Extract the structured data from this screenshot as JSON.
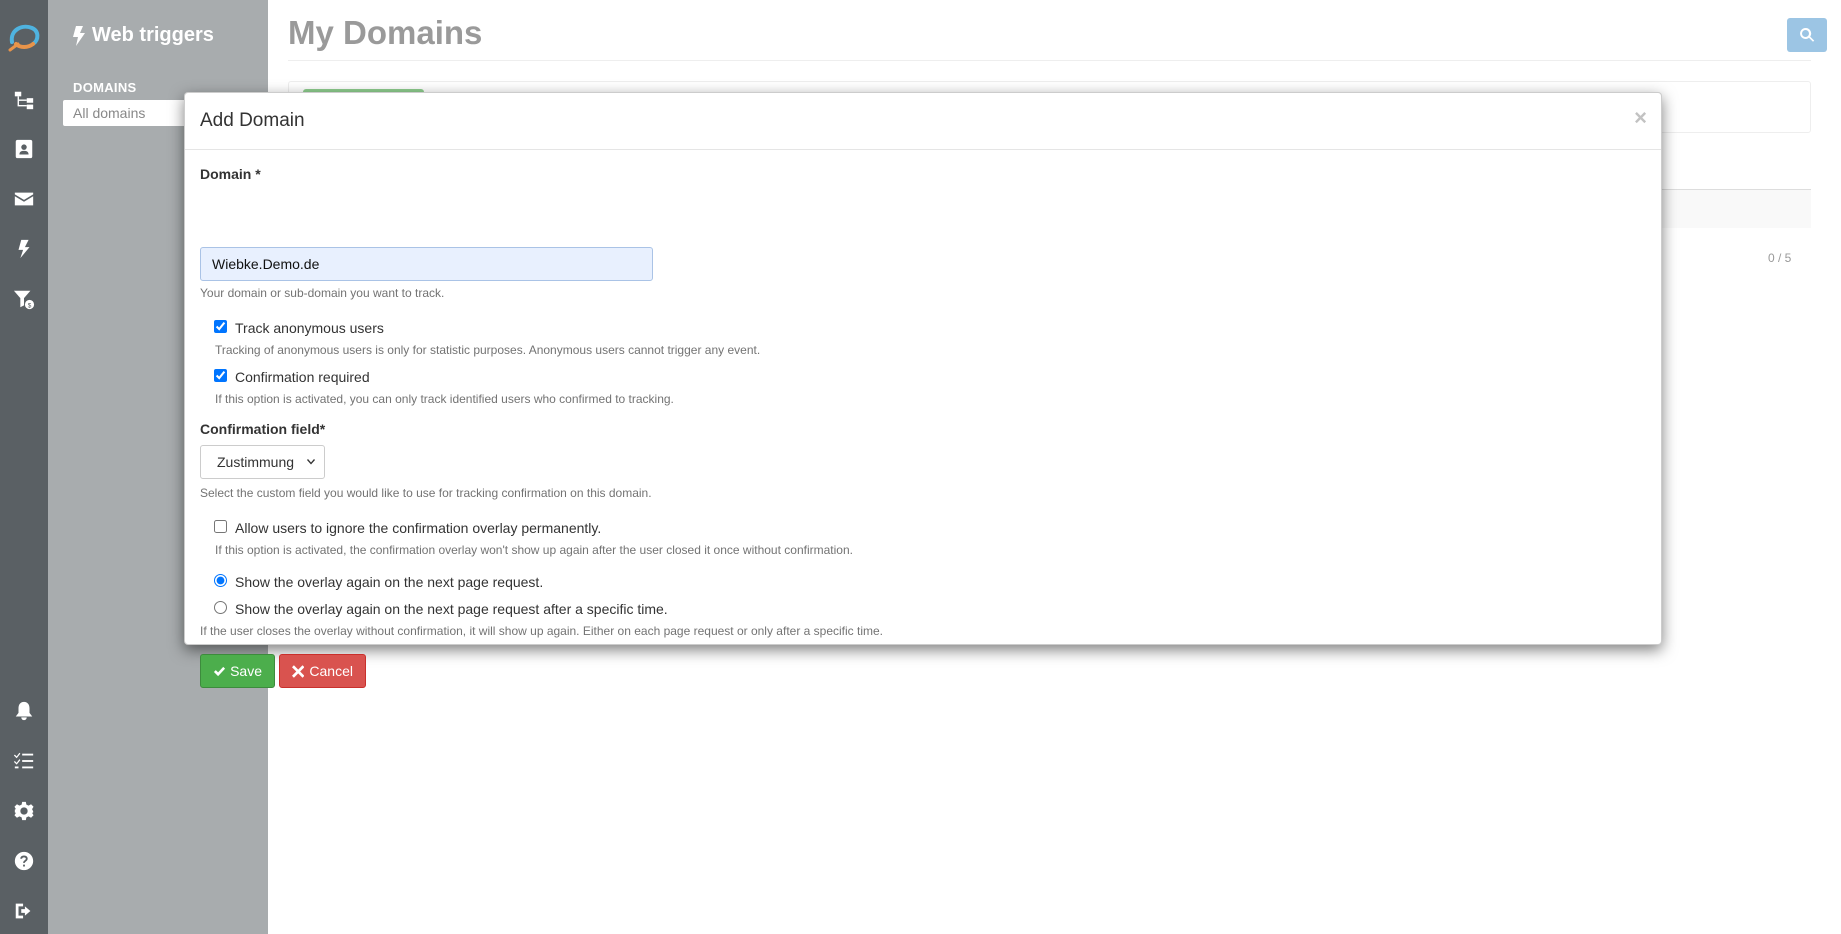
{
  "app": {
    "section_title": "Web triggers",
    "sidebar_heading": "DOMAINS",
    "sidebar_item": "All domains"
  },
  "main": {
    "page_title": "My Domains",
    "pagination_count": "0 / 5"
  },
  "modal": {
    "title": "Add Domain",
    "close": "×",
    "domain_label": "Domain *",
    "domain_value": "Wiebke.Demo.de",
    "domain_help": "Your domain or sub-domain you want to track.",
    "track_anon_label": "Track anonymous users",
    "track_anon_checked": true,
    "track_anon_help": "Tracking of anonymous users is only for statistic purposes. Anonymous users cannot trigger any event.",
    "confirm_req_label": "Confirmation required",
    "confirm_req_checked": true,
    "confirm_req_help": "If this option is activated, you can only track identified users who confirmed to tracking.",
    "confirm_field_label": "Confirmation field*",
    "confirm_field_value": "Zustimmung",
    "confirm_field_help": "Select the custom field you would like to use for tracking confirmation on this domain.",
    "allow_ignore_label": "Allow users to ignore the confirmation overlay permanently.",
    "allow_ignore_checked": false,
    "allow_ignore_help": "If this option is activated, the confirmation overlay won't show up again after the user closed it once without confirmation.",
    "radio_next_label": "Show the overlay again on the next page request.",
    "radio_time_label": "Show the overlay again on the next page request after a specific time.",
    "radio_selected": "next",
    "radio_help": "If the user closes the overlay without confirmation, it will show up again. Either on each page request or only after a specific time.",
    "save_label": "Save",
    "cancel_label": "Cancel"
  },
  "icons": {
    "rail": [
      "logo-icon",
      "workflow-icon",
      "contacts-icon",
      "email-icon",
      "bolt-icon",
      "funnel-icon",
      "bell-icon",
      "checklist-icon",
      "gear-icon",
      "help-icon",
      "logout-icon"
    ]
  },
  "colors": {
    "rail": "#5a6064",
    "sidebar": "#a8acae",
    "save": "#4cae4c",
    "cancel": "#d9534f",
    "search": "#9cc5e4"
  }
}
